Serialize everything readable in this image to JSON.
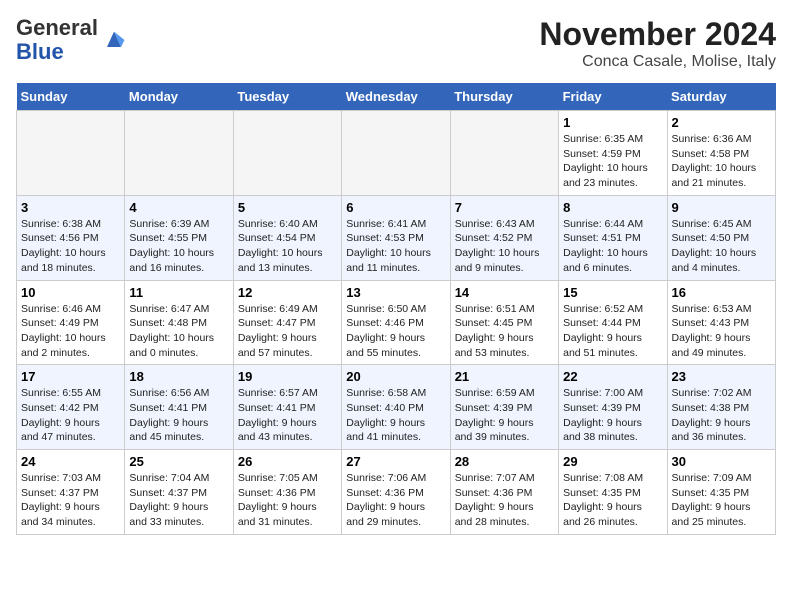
{
  "header": {
    "logo_line1": "General",
    "logo_line2": "Blue",
    "month": "November 2024",
    "location": "Conca Casale, Molise, Italy"
  },
  "weekdays": [
    "Sunday",
    "Monday",
    "Tuesday",
    "Wednesday",
    "Thursday",
    "Friday",
    "Saturday"
  ],
  "weeks": [
    [
      {
        "day": "",
        "info": ""
      },
      {
        "day": "",
        "info": ""
      },
      {
        "day": "",
        "info": ""
      },
      {
        "day": "",
        "info": ""
      },
      {
        "day": "",
        "info": ""
      },
      {
        "day": "1",
        "info": "Sunrise: 6:35 AM\nSunset: 4:59 PM\nDaylight: 10 hours\nand 23 minutes."
      },
      {
        "day": "2",
        "info": "Sunrise: 6:36 AM\nSunset: 4:58 PM\nDaylight: 10 hours\nand 21 minutes."
      }
    ],
    [
      {
        "day": "3",
        "info": "Sunrise: 6:38 AM\nSunset: 4:56 PM\nDaylight: 10 hours\nand 18 minutes."
      },
      {
        "day": "4",
        "info": "Sunrise: 6:39 AM\nSunset: 4:55 PM\nDaylight: 10 hours\nand 16 minutes."
      },
      {
        "day": "5",
        "info": "Sunrise: 6:40 AM\nSunset: 4:54 PM\nDaylight: 10 hours\nand 13 minutes."
      },
      {
        "day": "6",
        "info": "Sunrise: 6:41 AM\nSunset: 4:53 PM\nDaylight: 10 hours\nand 11 minutes."
      },
      {
        "day": "7",
        "info": "Sunrise: 6:43 AM\nSunset: 4:52 PM\nDaylight: 10 hours\nand 9 minutes."
      },
      {
        "day": "8",
        "info": "Sunrise: 6:44 AM\nSunset: 4:51 PM\nDaylight: 10 hours\nand 6 minutes."
      },
      {
        "day": "9",
        "info": "Sunrise: 6:45 AM\nSunset: 4:50 PM\nDaylight: 10 hours\nand 4 minutes."
      }
    ],
    [
      {
        "day": "10",
        "info": "Sunrise: 6:46 AM\nSunset: 4:49 PM\nDaylight: 10 hours\nand 2 minutes."
      },
      {
        "day": "11",
        "info": "Sunrise: 6:47 AM\nSunset: 4:48 PM\nDaylight: 10 hours\nand 0 minutes."
      },
      {
        "day": "12",
        "info": "Sunrise: 6:49 AM\nSunset: 4:47 PM\nDaylight: 9 hours\nand 57 minutes."
      },
      {
        "day": "13",
        "info": "Sunrise: 6:50 AM\nSunset: 4:46 PM\nDaylight: 9 hours\nand 55 minutes."
      },
      {
        "day": "14",
        "info": "Sunrise: 6:51 AM\nSunset: 4:45 PM\nDaylight: 9 hours\nand 53 minutes."
      },
      {
        "day": "15",
        "info": "Sunrise: 6:52 AM\nSunset: 4:44 PM\nDaylight: 9 hours\nand 51 minutes."
      },
      {
        "day": "16",
        "info": "Sunrise: 6:53 AM\nSunset: 4:43 PM\nDaylight: 9 hours\nand 49 minutes."
      }
    ],
    [
      {
        "day": "17",
        "info": "Sunrise: 6:55 AM\nSunset: 4:42 PM\nDaylight: 9 hours\nand 47 minutes."
      },
      {
        "day": "18",
        "info": "Sunrise: 6:56 AM\nSunset: 4:41 PM\nDaylight: 9 hours\nand 45 minutes."
      },
      {
        "day": "19",
        "info": "Sunrise: 6:57 AM\nSunset: 4:41 PM\nDaylight: 9 hours\nand 43 minutes."
      },
      {
        "day": "20",
        "info": "Sunrise: 6:58 AM\nSunset: 4:40 PM\nDaylight: 9 hours\nand 41 minutes."
      },
      {
        "day": "21",
        "info": "Sunrise: 6:59 AM\nSunset: 4:39 PM\nDaylight: 9 hours\nand 39 minutes."
      },
      {
        "day": "22",
        "info": "Sunrise: 7:00 AM\nSunset: 4:39 PM\nDaylight: 9 hours\nand 38 minutes."
      },
      {
        "day": "23",
        "info": "Sunrise: 7:02 AM\nSunset: 4:38 PM\nDaylight: 9 hours\nand 36 minutes."
      }
    ],
    [
      {
        "day": "24",
        "info": "Sunrise: 7:03 AM\nSunset: 4:37 PM\nDaylight: 9 hours\nand 34 minutes."
      },
      {
        "day": "25",
        "info": "Sunrise: 7:04 AM\nSunset: 4:37 PM\nDaylight: 9 hours\nand 33 minutes."
      },
      {
        "day": "26",
        "info": "Sunrise: 7:05 AM\nSunset: 4:36 PM\nDaylight: 9 hours\nand 31 minutes."
      },
      {
        "day": "27",
        "info": "Sunrise: 7:06 AM\nSunset: 4:36 PM\nDaylight: 9 hours\nand 29 minutes."
      },
      {
        "day": "28",
        "info": "Sunrise: 7:07 AM\nSunset: 4:36 PM\nDaylight: 9 hours\nand 28 minutes."
      },
      {
        "day": "29",
        "info": "Sunrise: 7:08 AM\nSunset: 4:35 PM\nDaylight: 9 hours\nand 26 minutes."
      },
      {
        "day": "30",
        "info": "Sunrise: 7:09 AM\nSunset: 4:35 PM\nDaylight: 9 hours\nand 25 minutes."
      }
    ]
  ]
}
